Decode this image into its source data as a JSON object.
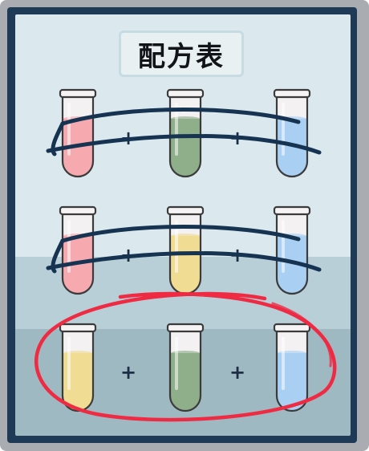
{
  "title": "配方表",
  "plus_sign": "+",
  "recipes": [
    {
      "tubes": [
        {
          "liquid": "pink",
          "color": "#f7a9b0"
        },
        {
          "liquid": "green",
          "color": "#8fae8a"
        },
        {
          "liquid": "blue",
          "color": "#a9cff2"
        }
      ],
      "status": "crossed-out"
    },
    {
      "tubes": [
        {
          "liquid": "pink",
          "color": "#f7a9b0"
        },
        {
          "liquid": "yellow",
          "color": "#f1dc94"
        },
        {
          "liquid": "blue",
          "color": "#a9cff2"
        }
      ],
      "status": "crossed-out"
    },
    {
      "tubes": [
        {
          "liquid": "yellow",
          "color": "#f1dc94"
        },
        {
          "liquid": "green",
          "color": "#8fae8a"
        },
        {
          "liquid": "blue",
          "color": "#a9cff2"
        }
      ],
      "status": "circled"
    }
  ],
  "colors": {
    "frame": "#a9adb1",
    "board_border": "#1f3a57",
    "panel_top": "#dbe9ef",
    "panel_mid": "#b8cfd8",
    "panel_bottom": "#9fb9c3",
    "strike": "#163451",
    "circle": "#ee2b43"
  },
  "icons": [
    "test-tube-icon",
    "plus-icon",
    "strike-scribble-icon",
    "circle-mark-icon"
  ]
}
